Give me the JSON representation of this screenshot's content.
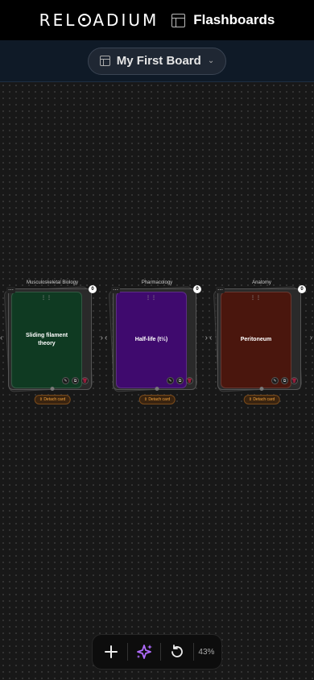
{
  "header": {
    "logo_text": "RELOADIUM",
    "app_name": "Flashboards"
  },
  "board_selector": {
    "label": "My First Board"
  },
  "cards": [
    {
      "category": "Musculoskeletal Biology",
      "title": "Sliding filament theory",
      "count": "0",
      "color": "#0f3a22",
      "detach_label": "Detach card"
    },
    {
      "category": "Pharmacology",
      "title": "Half-life (t½)",
      "count": "0",
      "color": "#3f0a6e",
      "detach_label": "Detach card"
    },
    {
      "category": "Anatomy",
      "title": "Peritoneum",
      "count": "0",
      "color": "#4a160d",
      "detach_label": "Detach card"
    }
  ],
  "toolbar": {
    "zoom_level": "43%"
  }
}
